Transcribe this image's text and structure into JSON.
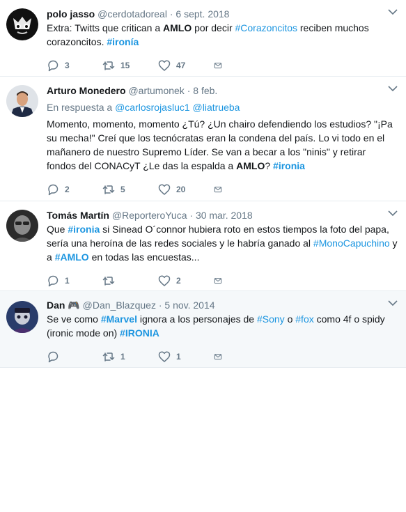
{
  "tweets": [
    {
      "name": "polo jasso",
      "handle": "@cerdotadoreal",
      "date": "6 sept. 2018",
      "segments": [
        {
          "t": "Extra: Twitts que critican a "
        },
        {
          "t": "AMLO",
          "bold": true
        },
        {
          "t": " por decir "
        },
        {
          "t": "#Corazoncitos",
          "link": true
        },
        {
          "t": " reciben muchos corazoncitos. "
        },
        {
          "t": "#ironía",
          "link": true,
          "bold": true
        }
      ],
      "replies": "3",
      "retweets": "15",
      "likes": "47"
    },
    {
      "name": "Arturo Monedero",
      "handle": "@artumonek",
      "date": "8 feb.",
      "reply_prefix": "En respuesta a",
      "reply_users": [
        "@carlosrojasluc1",
        "@liatrueba"
      ],
      "segments": [
        {
          "t": "Momento, momento, momento ¿Tú? ¿Un chairo defendiendo los estudios? \"¡Pa su mecha!\" Creí que los tecnócratas eran la condena del país. Lo vi todo en el mañanero de nuestro Supremo Líder. Se van a becar a los \"ninis\" y retirar fondos del CONACyT ¿Le das la espalda a "
        },
        {
          "t": "AMLO",
          "bold": true
        },
        {
          "t": "? "
        },
        {
          "t": "#ironia",
          "link": true,
          "bold": true
        }
      ],
      "replies": "2",
      "retweets": "5",
      "likes": "20"
    },
    {
      "name": "Tomás Martín",
      "handle": "@ReporteroYuca",
      "date": "30 mar. 2018",
      "segments": [
        {
          "t": "Que "
        },
        {
          "t": "#ironia",
          "link": true,
          "bold": true
        },
        {
          "t": " si Sinead O´connor hubiera roto en estos tiempos la foto del papa, sería una heroína de las redes sociales y le habría ganado al "
        },
        {
          "t": "#MonoCapuchino",
          "link": true
        },
        {
          "t": " y a "
        },
        {
          "t": "#AMLO",
          "link": true,
          "bold": true
        },
        {
          "t": " en todas las encuestas..."
        }
      ],
      "replies": "1",
      "retweets": "",
      "likes": "2"
    },
    {
      "name": "Dan 🎮",
      "handle": "@Dan_Blazquez",
      "date": "5 nov. 2014",
      "segments": [
        {
          "t": "Se ve como "
        },
        {
          "t": "#Marvel",
          "link": true,
          "bold": true
        },
        {
          "t": " ignora a los personajes de "
        },
        {
          "t": "#Sony",
          "link": true
        },
        {
          "t": " o "
        },
        {
          "t": "#fox",
          "link": true
        },
        {
          "t": " como 4f o spidy (ironic mode on) "
        },
        {
          "t": "#IRONIA",
          "link": true,
          "bold": true
        }
      ],
      "replies": "",
      "retweets": "1",
      "likes": "1"
    }
  ],
  "icons": {
    "reply": "reply-icon",
    "retweet": "retweet-icon",
    "like": "heart-icon",
    "dm": "envelope-icon",
    "menu": "chevron-down-icon"
  },
  "colors": {
    "link": "#1b95e0",
    "meta": "#657786",
    "text": "#14171a",
    "highlight_bg": "#f5f8fa"
  }
}
